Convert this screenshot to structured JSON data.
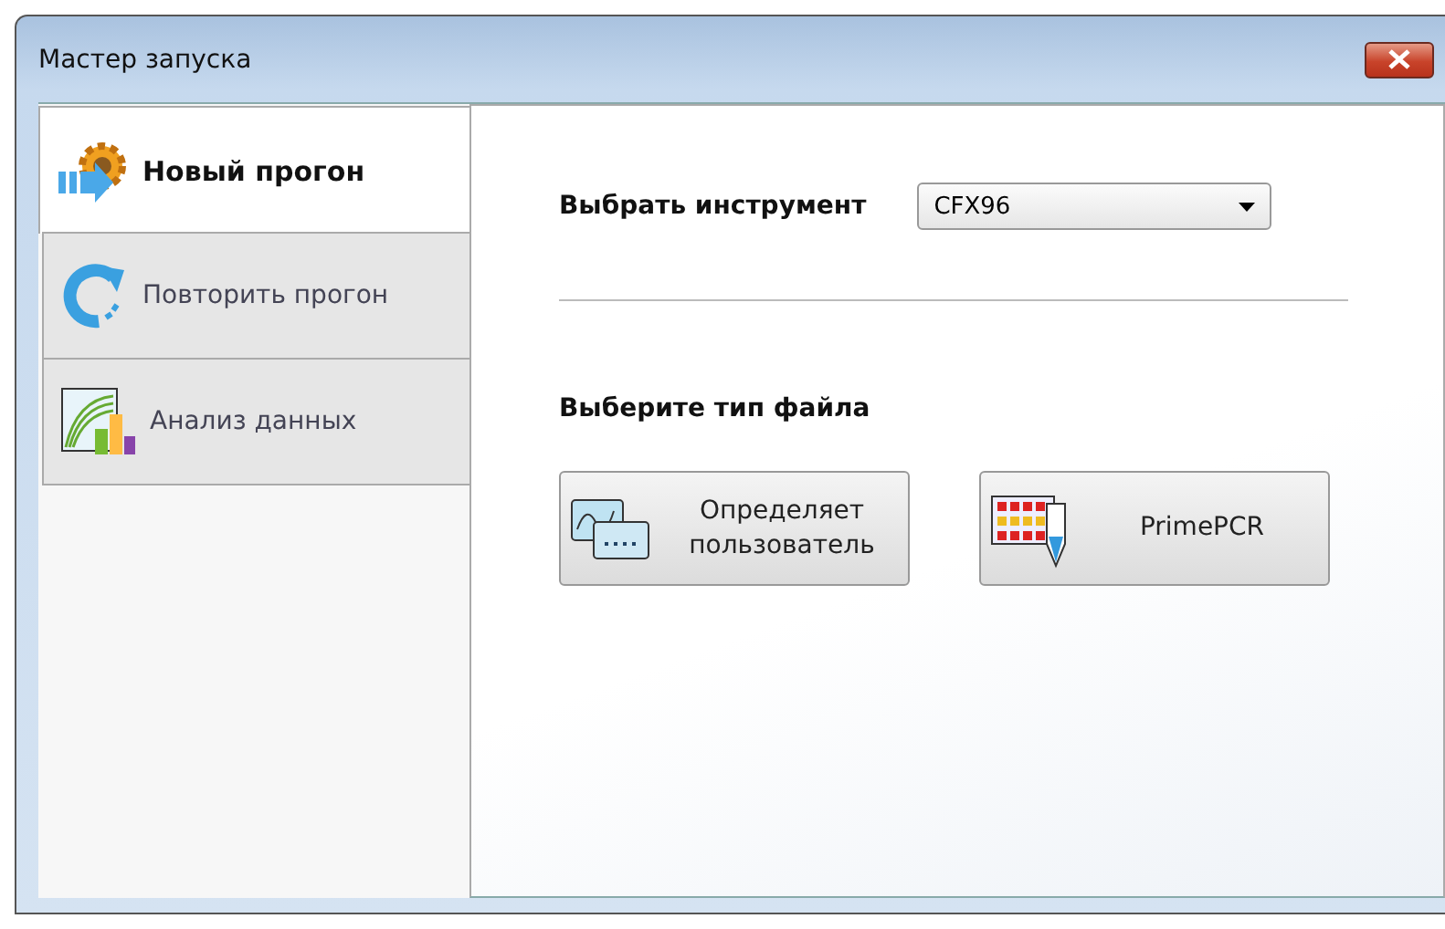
{
  "window": {
    "title": "Мастер запуска"
  },
  "tabs": [
    {
      "label": "Новый прогон",
      "kind": "gear",
      "selected": true
    },
    {
      "label": "Повторить прогон",
      "kind": "repeat",
      "selected": false
    },
    {
      "label": "Анализ данных",
      "kind": "chart",
      "selected": false
    }
  ],
  "instrument": {
    "label": "Выбрать инструмент",
    "value": "CFX96"
  },
  "file_type": {
    "label": "Выберите тип файла",
    "buttons": [
      {
        "label": "Определяет пользователь",
        "kind": "plate"
      },
      {
        "label": "PrimePCR",
        "kind": "tube"
      }
    ]
  }
}
